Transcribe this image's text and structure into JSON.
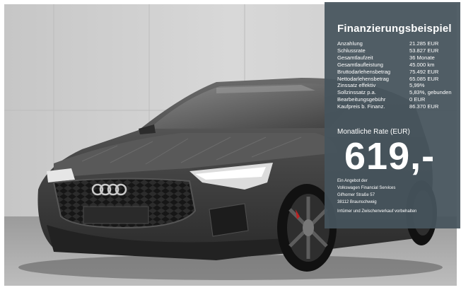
{
  "panel": {
    "title": "Finanzierungsbeispiel",
    "specs": [
      {
        "label": "Anzahlung",
        "value": "21.285 EUR"
      },
      {
        "label": "Schlussrate",
        "value": "53.827 EUR"
      },
      {
        "label": "Gesamtlaufzeit",
        "value": "36 Monate"
      },
      {
        "label": "Gesamtlaufleistung",
        "value": "45.000 km"
      },
      {
        "label": "Bruttodarlehensbetrag",
        "value": "75.492 EUR"
      },
      {
        "label": "Nettodarlehensbetrag",
        "value": "65.085 EUR"
      },
      {
        "label": "Zinssatz effektiv",
        "value": "5,99%"
      },
      {
        "label": "Sollzinssatz p.a.",
        "value": "5,83%, gebunden"
      },
      {
        "label": "Bearbeitungsgebühr",
        "value": "0 EUR"
      },
      {
        "label": "Kaufpreis b. Finanz.",
        "value": "86.370 EUR"
      }
    ],
    "rate_label": "Monatliche Rate (EUR)",
    "rate_value": "619,-",
    "offer_lines": [
      "Ein Angebot der",
      "Volkswagen Financial Services",
      "Gifhorner Straße 57",
      "38112 Braunschweig"
    ],
    "note": "Irrtümer und Zwischenverkauf vorbehalten"
  },
  "colors": {
    "panel_bg": "#46545d",
    "wall": "#cfcfcf",
    "floor": "#a9a9a9",
    "car_body": "#3c3c3c"
  }
}
